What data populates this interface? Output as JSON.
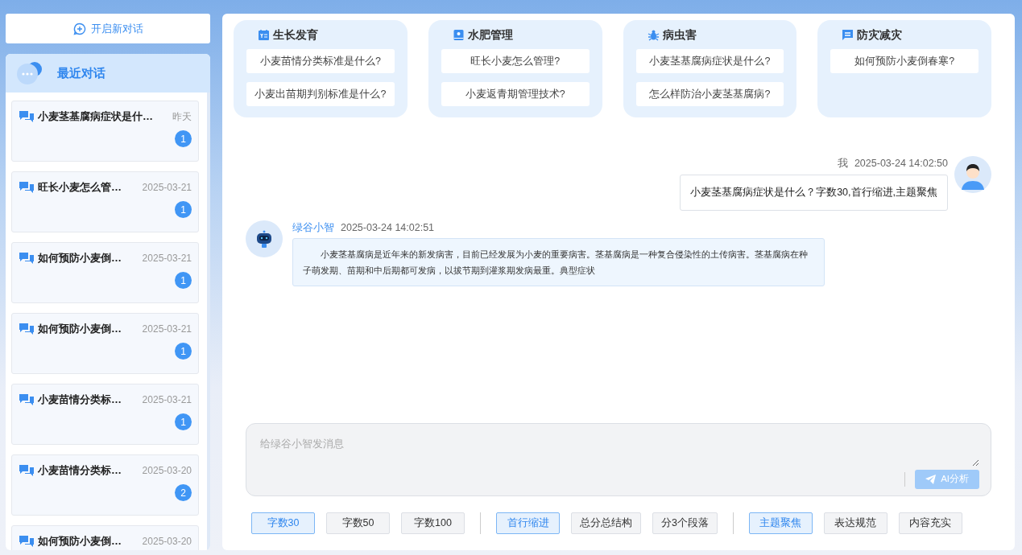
{
  "new_chat_button": "开启新对话",
  "recent": {
    "title": "最近对话",
    "items": [
      {
        "title": "小麦茎基腐病症状是什…",
        "date": "昨天",
        "count": "1"
      },
      {
        "title": "旺长小麦怎么管…",
        "date": "2025-03-21",
        "count": "1"
      },
      {
        "title": "如何预防小麦倒…",
        "date": "2025-03-21",
        "count": "1"
      },
      {
        "title": "如何预防小麦倒…",
        "date": "2025-03-21",
        "count": "1"
      },
      {
        "title": "小麦苗情分类标…",
        "date": "2025-03-21",
        "count": "1"
      },
      {
        "title": "小麦苗情分类标…",
        "date": "2025-03-20",
        "count": "2"
      },
      {
        "title": "如何预防小麦倒…",
        "date": "2025-03-20"
      }
    ]
  },
  "categories": [
    {
      "kind": "growth",
      "title": "生长发育",
      "questions": [
        "小麦苗情分类标准是什么?",
        "小麦出苗期判别标准是什么?"
      ]
    },
    {
      "kind": "water",
      "title": "水肥管理",
      "questions": [
        "旺长小麦怎么管理?",
        "小麦返青期管理技术?"
      ]
    },
    {
      "kind": "pest",
      "title": "病虫害",
      "questions": [
        "小麦茎基腐病症状是什么?",
        "怎么样防治小麦茎基腐病?"
      ]
    },
    {
      "kind": "disaster",
      "title": "防灾减灾",
      "questions": [
        "如何预防小麦倒春寒?"
      ]
    }
  ],
  "messages": [
    {
      "kind": "user",
      "sender": "我",
      "time": "2025-03-24 14:02:50",
      "text": "小麦茎基腐病症状是什么？字数30,首行缩进,主题聚焦"
    },
    {
      "kind": "bot",
      "sender": "绿谷小智",
      "time": "2025-03-24 14:02:51",
      "text": "小麦茎基腐病是近年来的新发病害，目前已经发展为小麦的重要病害。茎基腐病是一种复合侵染性的土传病害。茎基腐病在种子萌发期、苗期和中后期都可发病，以拔节期到灌浆期发病最重。典型症状"
    }
  ],
  "composer": {
    "placeholder": "给绿谷小智发消息",
    "send_button": "AI分析",
    "send_disabled": true
  },
  "option_groups": [
    [
      {
        "label": "字数30",
        "selected": true
      },
      {
        "label": "字数50",
        "selected": false
      },
      {
        "label": "字数100",
        "selected": false
      }
    ],
    [
      {
        "label": "首行缩进",
        "selected": true
      },
      {
        "label": "总分总结构",
        "selected": false
      },
      {
        "label": "分3个段落",
        "selected": false
      }
    ],
    [
      {
        "label": "主题聚焦",
        "selected": true
      },
      {
        "label": "表达规范",
        "selected": false
      },
      {
        "label": "内容充实",
        "selected": false
      }
    ]
  ]
}
